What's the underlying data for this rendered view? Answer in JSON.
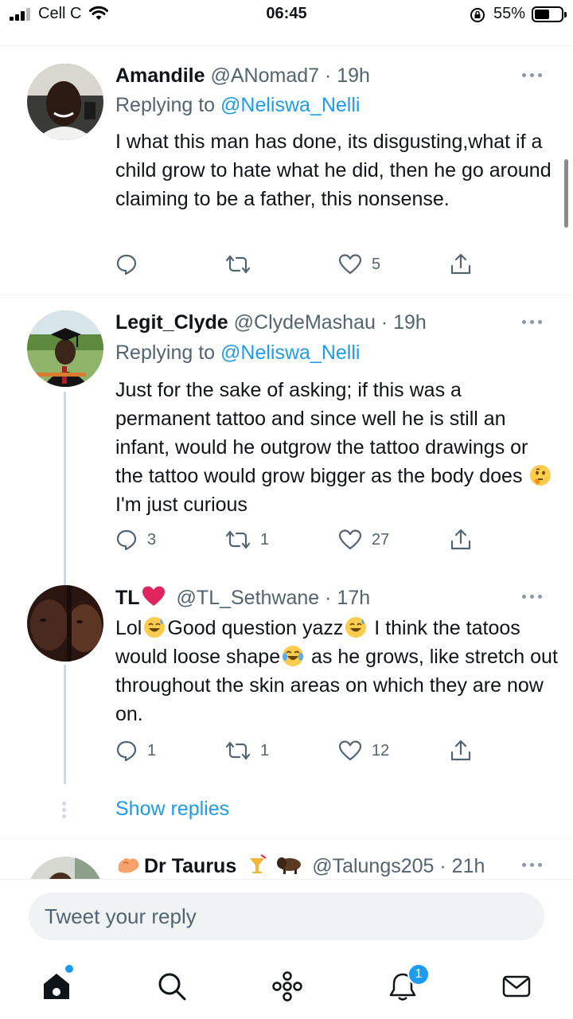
{
  "status_bar": {
    "carrier": "Cell C",
    "time": "06:45",
    "battery_percent": "55%",
    "battery_level": 0.55
  },
  "tweets": [
    {
      "name": "Amandile",
      "handle": "@ANomad7 · 19h",
      "replying_prefix": "Replying to ",
      "replying_to": "@Neliswa_Nelli",
      "text": "I what this man has done, its disgusting,what if a child grow to hate what he did, then he go around claiming to be a father, this nonsense.",
      "replies": "",
      "retweets": "",
      "likes": "5"
    },
    {
      "name": "Legit_Clyde",
      "handle": "@ClydeMashau · 19h",
      "replying_prefix": "Replying to ",
      "replying_to": "@Neliswa_Nelli",
      "text_1": "Just for the sake of asking; if this was a permanent tattoo and since well he is still an infant,  would he outgrow the tattoo drawings or the tattoo would grow bigger as the body does ",
      "text_2": " I'm just curious",
      "replies": "3",
      "retweets": "1",
      "likes": "27"
    },
    {
      "name": "TL",
      "handle": "@TL_Sethwane · 17h",
      "text_1": "Lol",
      "text_2": "Good question yazz",
      "text_3": "  I think the tatoos would loose shape",
      "text_4": "  as he grows, like stretch out throughout the skin areas on which  they are now on.",
      "replies": "1",
      "retweets": "1",
      "likes": "12"
    },
    {
      "name": "Dr Taurus",
      "handle": "@Talungs205 · 21h"
    }
  ],
  "show_replies": "Show replies",
  "composer": {
    "placeholder": "Tweet your reply"
  },
  "nav": {
    "notifications_badge": "1",
    "icons": [
      "home-icon",
      "search-icon",
      "spaces-icon",
      "notifications-icon",
      "messages-icon"
    ]
  },
  "colors": {
    "accent": "#1d9bf0",
    "text": "#0f1419",
    "secondary": "#536471",
    "heart": "#e0245e"
  }
}
